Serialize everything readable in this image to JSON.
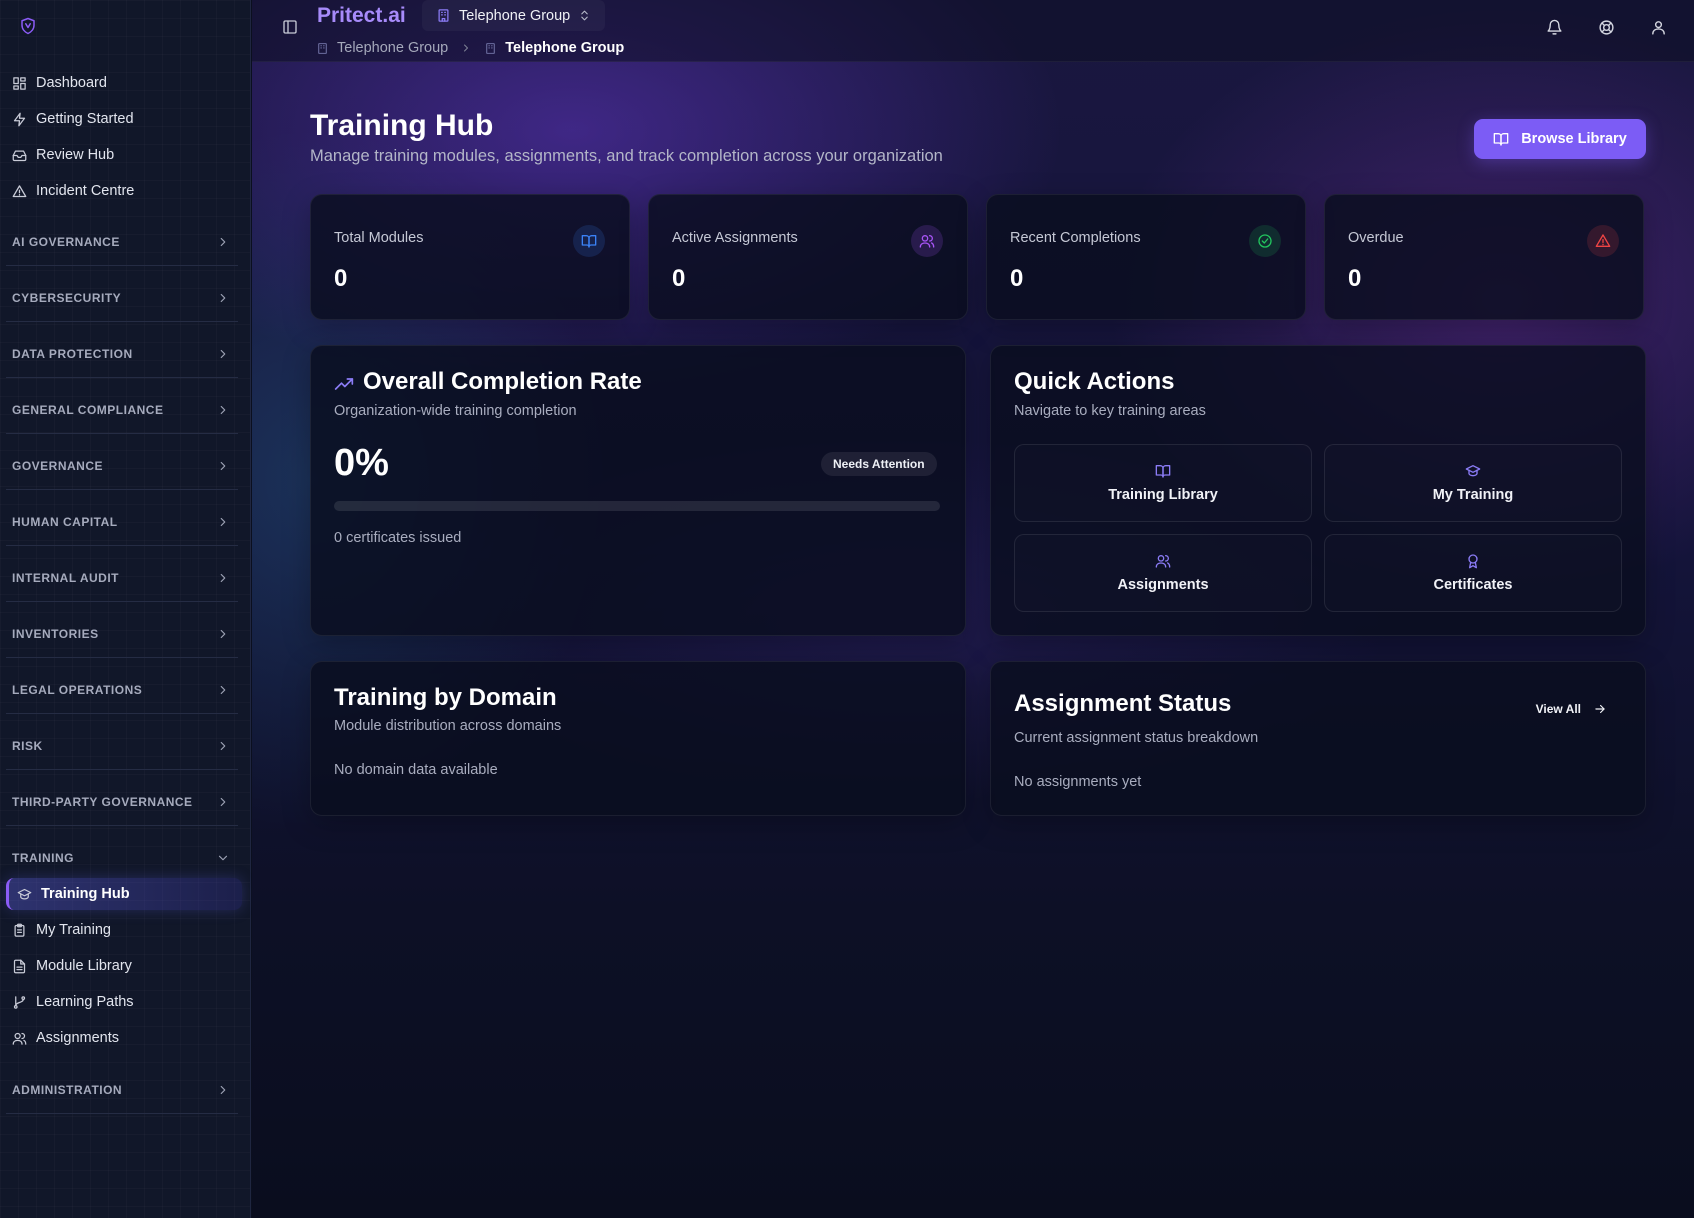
{
  "app": {
    "brand": "Pritect.ai",
    "org": "Telephone Group"
  },
  "breadcrumb": [
    "Telephone Group",
    "Telephone Group"
  ],
  "sidebar": {
    "top_items": [
      {
        "label": "Dashboard",
        "icon": "grid-icon"
      },
      {
        "label": "Getting Started",
        "icon": "zap-icon"
      },
      {
        "label": "Review Hub",
        "icon": "inbox-icon"
      },
      {
        "label": "Incident Centre",
        "icon": "alert-triangle-icon"
      }
    ],
    "sections": [
      "AI GOVERNANCE",
      "CYBERSECURITY",
      "DATA PROTECTION",
      "GENERAL COMPLIANCE",
      "GOVERNANCE",
      "HUMAN CAPITAL",
      "INTERNAL AUDIT",
      "INVENTORIES",
      "LEGAL OPERATIONS",
      "RISK",
      "THIRD-PARTY GOVERNANCE"
    ],
    "training_section": "TRAINING",
    "training_items": [
      {
        "label": "Training Hub",
        "icon": "graduation-cap-icon",
        "active": true
      },
      {
        "label": "My Training",
        "icon": "clipboard-icon"
      },
      {
        "label": "Module Library",
        "icon": "file-text-icon"
      },
      {
        "label": "Learning Paths",
        "icon": "git-branch-icon"
      },
      {
        "label": "Assignments",
        "icon": "users-icon"
      }
    ],
    "admin_section": "ADMINISTRATION"
  },
  "page": {
    "title": "Training Hub",
    "subtitle": "Manage training modules, assignments, and track completion across your organization",
    "browse_button": "Browse Library"
  },
  "stats": [
    {
      "label": "Total Modules",
      "value": "0",
      "icon": "book-open-icon",
      "color": "#3b82f6"
    },
    {
      "label": "Active Assignments",
      "value": "0",
      "icon": "users-icon",
      "color": "#a855f7"
    },
    {
      "label": "Recent Completions",
      "value": "0",
      "icon": "check-circle-icon",
      "color": "#22c55e"
    },
    {
      "label": "Overdue",
      "value": "0",
      "icon": "alert-triangle-icon",
      "color": "#ef4444"
    }
  ],
  "completion": {
    "title": "Overall Completion Rate",
    "subtitle": "Organization-wide training completion",
    "percent_text": "0%",
    "percent": 0,
    "badge": "Needs Attention",
    "certificates": "0 certificates issued"
  },
  "quick_actions": {
    "title": "Quick Actions",
    "subtitle": "Navigate to key training areas",
    "items": [
      {
        "label": "Training Library",
        "icon": "book-open-icon"
      },
      {
        "label": "My Training",
        "icon": "graduation-cap-icon"
      },
      {
        "label": "Assignments",
        "icon": "users-icon"
      },
      {
        "label": "Certificates",
        "icon": "award-icon"
      }
    ]
  },
  "domain": {
    "title": "Training by Domain",
    "subtitle": "Module distribution across domains",
    "empty": "No domain data available"
  },
  "assignment_status": {
    "title": "Assignment Status",
    "subtitle": "Current assignment status breakdown",
    "view_all": "View All",
    "empty": "No assignments yet"
  },
  "colors": {
    "accent": "#7c5cf5",
    "brand": "#a78bfa"
  }
}
